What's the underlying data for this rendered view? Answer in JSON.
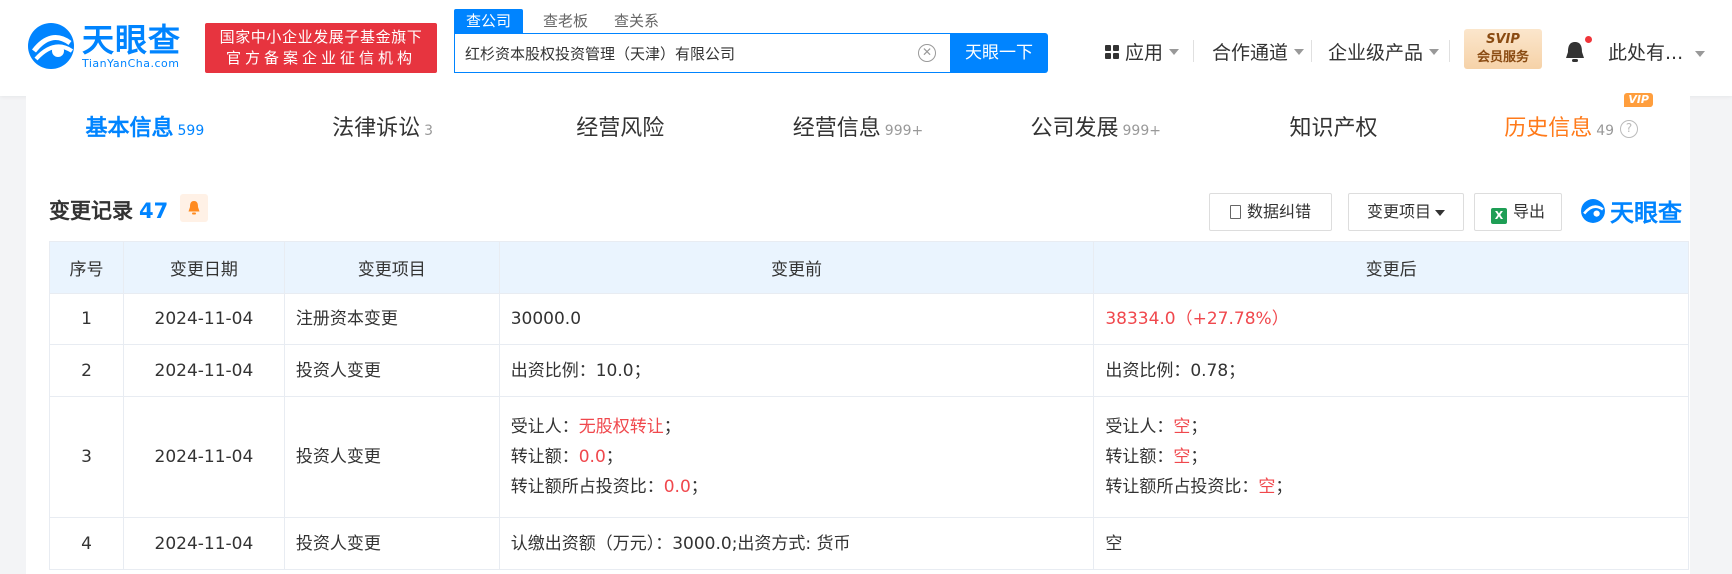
{
  "header": {
    "logo_cn": "天眼查",
    "logo_en": "TianYanCha.com",
    "slogan_line1": "国家中小企业发展子基金旗下",
    "slogan_line2": "官方备案企业征信机构",
    "search_tabs": [
      "查公司",
      "查老板",
      "查关系"
    ],
    "search_value": "红杉资本股权投资管理（天津）有限公司",
    "search_button": "天眼一下",
    "nav": {
      "apps": "应用",
      "channels": "合作通道",
      "enterprise": "企业级产品",
      "svip_top": "SVIP",
      "svip_bottom": "会员服务",
      "user": "此处有..."
    }
  },
  "tabs": [
    {
      "label": "基本信息",
      "count": "599"
    },
    {
      "label": "法律诉讼",
      "count": "3"
    },
    {
      "label": "经营风险",
      "count": ""
    },
    {
      "label": "经营信息",
      "count": "999+"
    },
    {
      "label": "公司发展",
      "count": "999+"
    },
    {
      "label": "知识产权",
      "count": ""
    },
    {
      "label": "历史信息",
      "count": "49",
      "badge": "VIP"
    }
  ],
  "section": {
    "title": "变更记录",
    "count": "47",
    "correct_button": "数据纠错",
    "filter_button": "变更项目",
    "export_button": "导出",
    "brand": "天眼查"
  },
  "table": {
    "headers": [
      "序号",
      "变更日期",
      "变更项目",
      "变更前",
      "变更后"
    ],
    "rows": [
      {
        "no": "1",
        "date": "2024-11-04",
        "item": "注册资本变更",
        "before": "30000.0",
        "after": "38334.0（+27.78%）"
      },
      {
        "no": "2",
        "date": "2024-11-04",
        "item": "投资人变更",
        "before": "出资比例：10.0；",
        "after": "出资比例：0.78；"
      },
      {
        "no": "3",
        "date": "2024-11-04",
        "item": "投资人变更",
        "before_lines": [
          {
            "label": "受让人：",
            "value": "无股权转让",
            "suffix": "；"
          },
          {
            "label": "转让额：",
            "value": "0.0",
            "suffix": "；"
          },
          {
            "label": "转让额所占投资比：",
            "value": "0.0",
            "suffix": "；"
          }
        ],
        "after_lines": [
          {
            "label": "受让人：",
            "value": "空",
            "suffix": "；"
          },
          {
            "label": "转让额：",
            "value": "空",
            "suffix": "；"
          },
          {
            "label": "转让额所占投资比：",
            "value": "空",
            "suffix": "；"
          }
        ]
      },
      {
        "no": "4",
        "date": "2024-11-04",
        "item": "投资人变更",
        "before": "认缴出资额（万元）：3000.0;出资方式: 货币",
        "after": "空"
      }
    ]
  },
  "colors": {
    "brand_blue": "#0084ff",
    "slogan_red": "#e7343f",
    "highlight_red": "#f0484d",
    "history_orange": "#ff7a1a",
    "table_header_bg": "#eaf4fe"
  }
}
